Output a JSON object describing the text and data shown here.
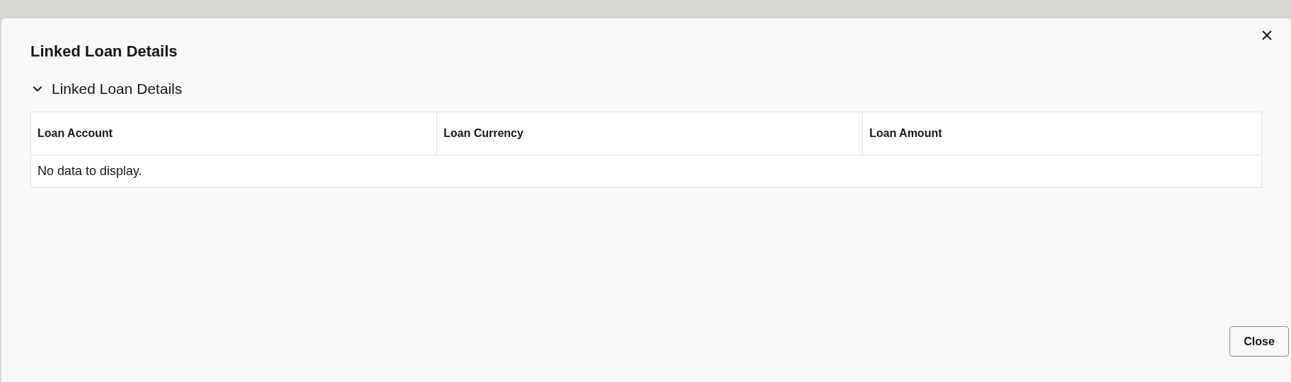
{
  "dialog": {
    "title": "Linked Loan Details"
  },
  "section": {
    "title": "Linked Loan Details",
    "expanded": true
  },
  "table": {
    "columns": [
      "Loan Account",
      "Loan Currency",
      "Loan Amount"
    ],
    "empty_message": "No data to display."
  },
  "buttons": [
    "Close"
  ]
}
